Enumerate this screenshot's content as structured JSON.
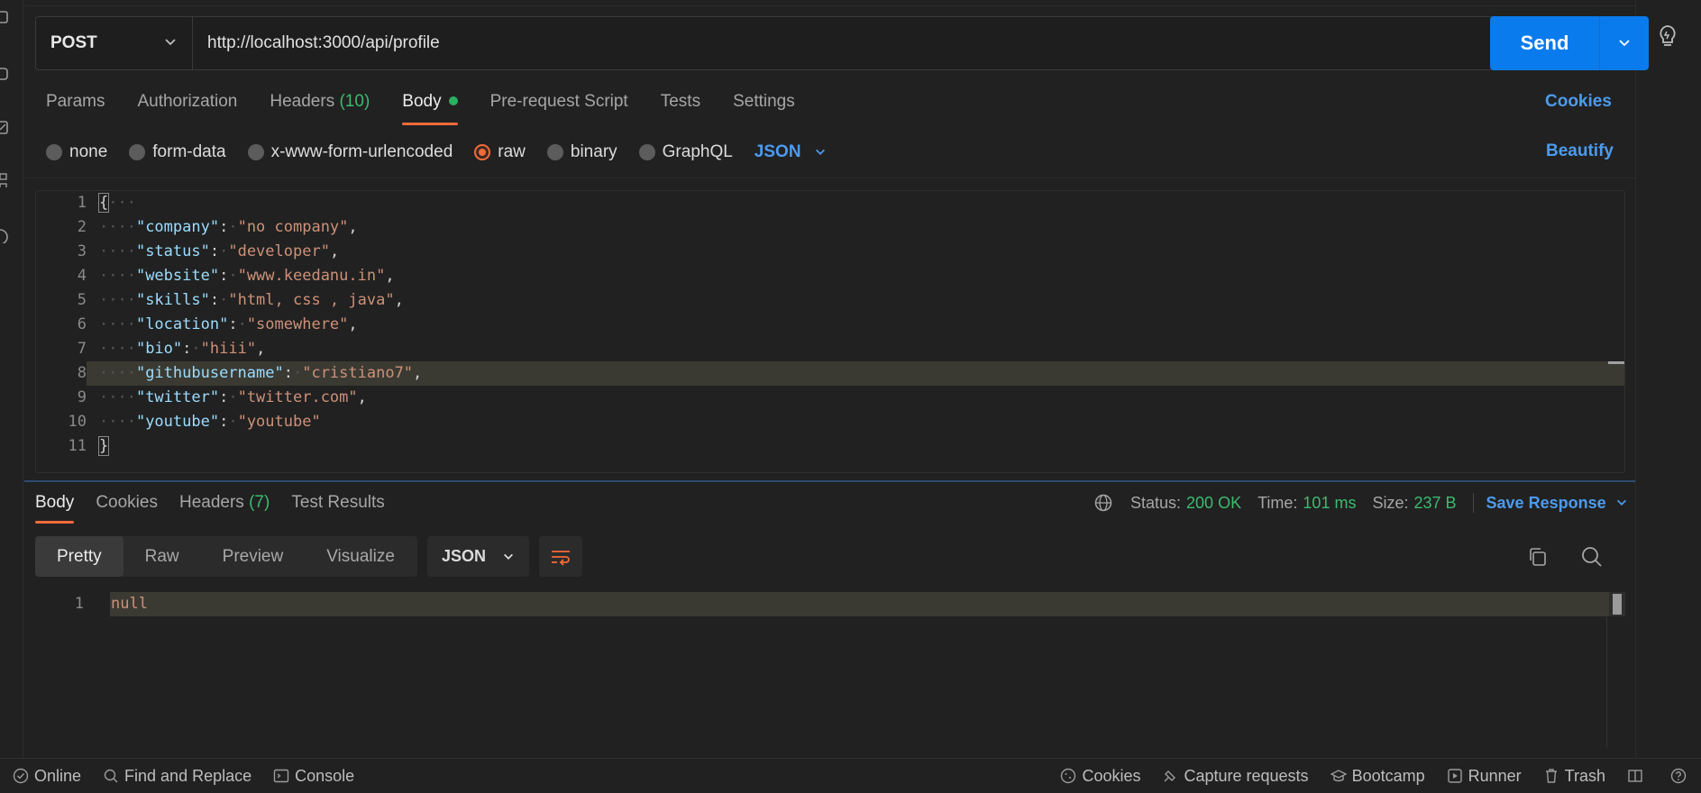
{
  "request": {
    "method": "POST",
    "url": "http://localhost:3000/api/profile",
    "send_label": "Send"
  },
  "tabs": [
    {
      "label": "Params"
    },
    {
      "label": "Authorization"
    },
    {
      "label": "Headers",
      "count": "(10)"
    },
    {
      "label": "Body"
    },
    {
      "label": "Pre-request Script"
    },
    {
      "label": "Tests"
    },
    {
      "label": "Settings"
    }
  ],
  "cookies_label": "Cookies",
  "body_types": [
    {
      "label": "none"
    },
    {
      "label": "form-data"
    },
    {
      "label": "x-www-form-urlencoded"
    },
    {
      "label": "raw"
    },
    {
      "label": "binary"
    },
    {
      "label": "GraphQL"
    }
  ],
  "body_format": "JSON",
  "beautify_label": "Beautify",
  "editor": {
    "line_numbers": [
      "1",
      "2",
      "3",
      "4",
      "5",
      "6",
      "7",
      "8",
      "9",
      "10",
      "11"
    ],
    "open_brace": "{",
    "close_brace": "}",
    "fields": [
      {
        "key": "\"company\"",
        "value": "\"no company\"",
        "comma": ","
      },
      {
        "key": "\"status\"",
        "value": "\"developer\"",
        "comma": ","
      },
      {
        "key": "\"website\"",
        "value": "\"www.keedanu.in\"",
        "comma": ","
      },
      {
        "key": "\"skills\"",
        "value": "\"html, css , java\"",
        "comma": ","
      },
      {
        "key": "\"location\"",
        "value": "\"somewhere\"",
        "comma": ","
      },
      {
        "key": "\"bio\"",
        "value": "\"hiii\"",
        "comma": ","
      },
      {
        "key": "\"githubusername\"",
        "value": "\"cristiano7\"",
        "comma": ","
      },
      {
        "key": "\"twitter\"",
        "value": "\"twitter.com\"",
        "comma": ","
      },
      {
        "key": "\"youtube\"",
        "value": "\"youtube\"",
        "comma": ""
      }
    ]
  },
  "response": {
    "tabs": [
      {
        "label": "Body"
      },
      {
        "label": "Cookies"
      },
      {
        "label": "Headers",
        "count": "(7)"
      },
      {
        "label": "Test Results"
      }
    ],
    "status_label": "Status:",
    "status_value": "200 OK",
    "time_label": "Time:",
    "time_value": "101 ms",
    "size_label": "Size:",
    "size_value": "237 B",
    "save_label": "Save Response",
    "views": [
      {
        "label": "Pretty"
      },
      {
        "label": "Raw"
      },
      {
        "label": "Preview"
      },
      {
        "label": "Visualize"
      }
    ],
    "format": "JSON",
    "line_number": "1",
    "body": "null"
  },
  "status_bar": {
    "online": "Online",
    "find_replace": "Find and Replace",
    "console": "Console",
    "cookies": "Cookies",
    "capture": "Capture requests",
    "bootcamp": "Bootcamp",
    "runner": "Runner",
    "trash": "Trash"
  },
  "colors": {
    "accent": "#097bed",
    "active_tab": "#f26b3a",
    "success": "#3cba6e",
    "link": "#4c9bee"
  }
}
